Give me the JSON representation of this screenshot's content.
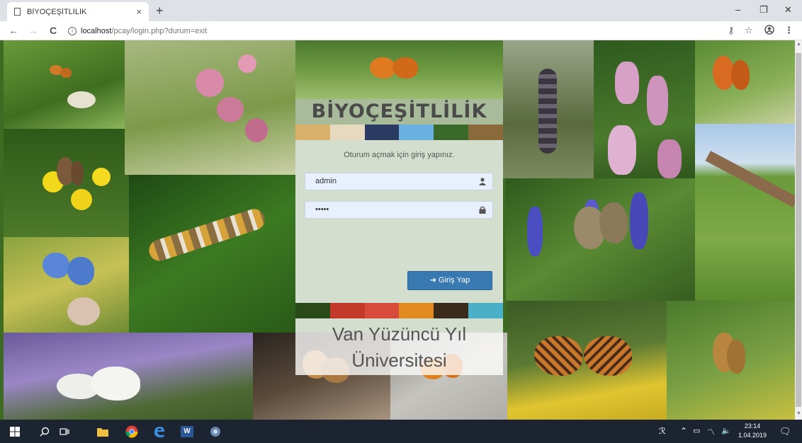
{
  "browser": {
    "tab_title": "BİYOÇEŞİTLİLİK",
    "tab_close": "×",
    "new_tab": "+",
    "url_host": "localhost",
    "url_path": "/pcay/login.php?durum=exit",
    "info_glyph": "i",
    "back_glyph": "←",
    "forward_glyph": "→",
    "reload_glyph": "C",
    "minimize_glyph": "–",
    "restore_glyph": "❐",
    "close_glyph": "✕",
    "key_glyph": "⚷",
    "star_glyph": "☆",
    "menu_glyph": "⋮"
  },
  "login": {
    "brand": "BİYOÇEŞİTLİLİK",
    "prompt": "Oturum açmak için giriş yapınız.",
    "username_value": "admin",
    "password_value": "•••••",
    "button_label": "Giriş Yap",
    "university_line1": "Van Yüzüncü Yıl",
    "university_line2": "Üniversitesi"
  },
  "taskbar": {
    "time": "23:14",
    "date": "1.04.2019",
    "word_label": "W"
  },
  "colors": {
    "accent_button": "#3779b0",
    "taskbar": "#1c2431",
    "input_bg": "#e8f0fe"
  }
}
